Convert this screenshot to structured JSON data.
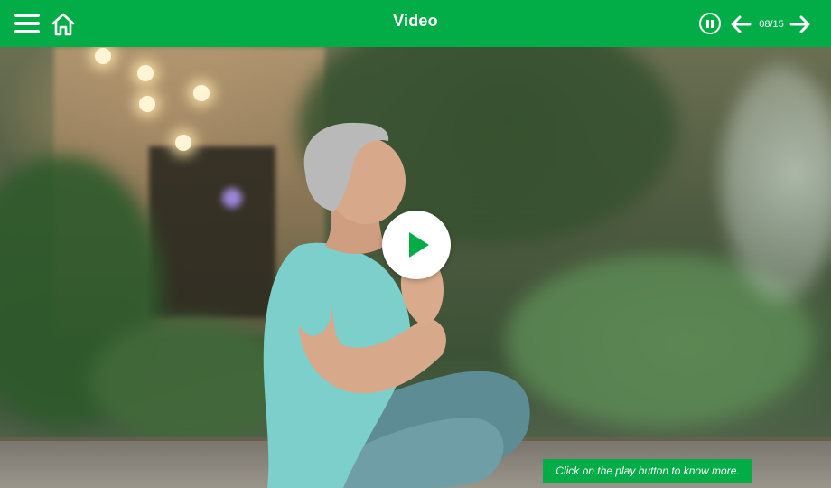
{
  "header": {
    "title": "Video",
    "page_counter": "08/15",
    "background_color": "#02ad47",
    "icons": {
      "menu": "hamburger-menu-icon",
      "home": "home-icon",
      "pause": "pause-circle-icon",
      "prev": "arrow-left-icon",
      "next": "arrow-right-icon"
    }
  },
  "video": {
    "play_icon": "play-icon",
    "play_icon_color": "#02ad47"
  },
  "hint": {
    "text": "Click on the play button to know more.",
    "background_color": "#02ad47"
  }
}
